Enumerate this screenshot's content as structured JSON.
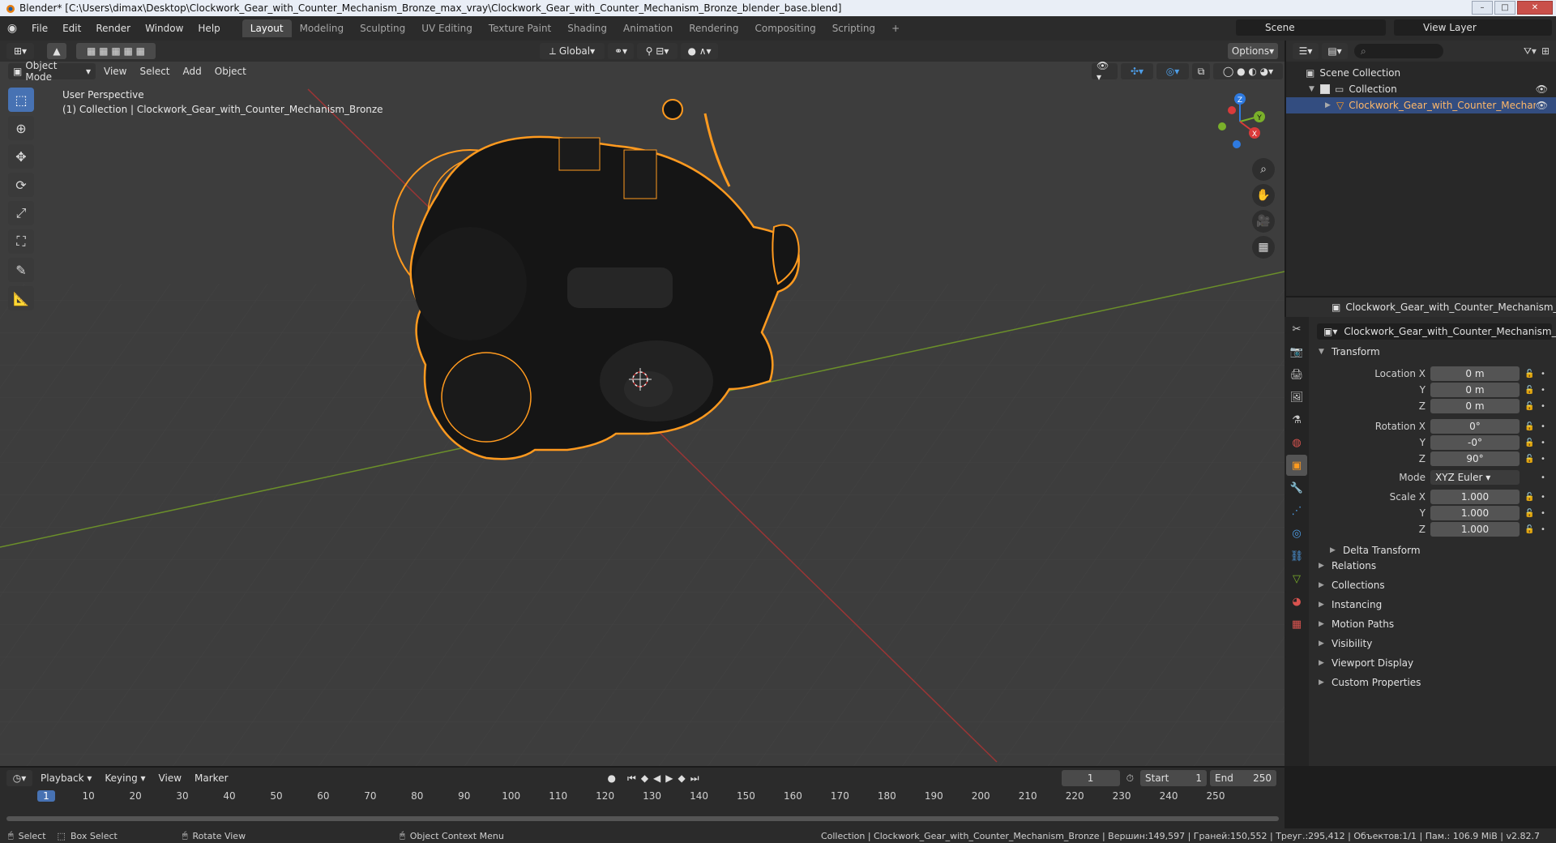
{
  "window": {
    "title": "Blender* [C:\\Users\\dimax\\Desktop\\Clockwork_Gear_with_Counter_Mechanism_Bronze_max_vray\\Clockwork_Gear_with_Counter_Mechanism_Bronze_blender_base.blend]",
    "minimize": "–",
    "maximize": "□",
    "close": "✕"
  },
  "menus": [
    "File",
    "Edit",
    "Render",
    "Window",
    "Help"
  ],
  "workspaces": [
    "Layout",
    "Modeling",
    "Sculpting",
    "UV Editing",
    "Texture Paint",
    "Shading",
    "Animation",
    "Rendering",
    "Compositing",
    "Scripting",
    "+"
  ],
  "active_workspace": "Layout",
  "scene": "Scene",
  "view_layer": "View Layer",
  "viewport": {
    "mode": "Object Mode",
    "menus": [
      "View",
      "Select",
      "Add",
      "Object"
    ],
    "orientation": "Global",
    "options": "Options",
    "perspective": "User Perspective",
    "collection_info": "(1) Collection | Clockwork_Gear_with_Counter_Mechanism_Bronze",
    "axis": {
      "x": "X",
      "y": "Y",
      "z": "Z"
    }
  },
  "outliner": {
    "scene_collection": "Scene Collection",
    "collection": "Collection",
    "object": "Clockwork_Gear_with_Counter_Mechanism_"
  },
  "properties": {
    "header_object": "Clockwork_Gear_with_Counter_Mechanism_Bronze",
    "object_name": "Clockwork_Gear_with_Counter_Mechanism_Bro...",
    "transform_title": "Transform",
    "location": {
      "label_x": "Location X",
      "label_y": "Y",
      "label_z": "Z",
      "x": "0 m",
      "y": "0 m",
      "z": "0 m"
    },
    "rotation": {
      "label_x": "Rotation X",
      "label_y": "Y",
      "label_z": "Z",
      "x": "0°",
      "y": "-0°",
      "z": "90°"
    },
    "mode": {
      "label": "Mode",
      "value": "XYZ Euler"
    },
    "scale": {
      "label_x": "Scale X",
      "label_y": "Y",
      "label_z": "Z",
      "x": "1.000",
      "y": "1.000",
      "z": "1.000"
    },
    "delta": "Delta Transform",
    "panels": [
      "Relations",
      "Collections",
      "Instancing",
      "Motion Paths",
      "Visibility",
      "Viewport Display",
      "Custom Properties"
    ]
  },
  "timeline": {
    "menus": [
      "Playback",
      "Keying",
      "View",
      "Marker"
    ],
    "current_frame": "1",
    "start_label": "Start",
    "start": "1",
    "end_label": "End",
    "end": "250",
    "ticks": [
      "1",
      "10",
      "20",
      "30",
      "40",
      "50",
      "60",
      "70",
      "80",
      "90",
      "100",
      "110",
      "120",
      "130",
      "140",
      "150",
      "160",
      "170",
      "180",
      "190",
      "200",
      "210",
      "220",
      "230",
      "240",
      "250"
    ]
  },
  "statusbar": {
    "select": "Select",
    "box_select": "Box Select",
    "rotate_view": "Rotate View",
    "context_menu": "Object Context Menu",
    "stats": "Collection | Clockwork_Gear_with_Counter_Mechanism_Bronze | Вершин:149,597 | Граней:150,552 | Треуг.:295,412 | Объектов:1/1 | Пам.: 106.9 MiB | v2.82.7"
  },
  "colors": {
    "accent": "#4772b3",
    "selection": "#ff9a1f",
    "background": "#3d3d3d"
  }
}
